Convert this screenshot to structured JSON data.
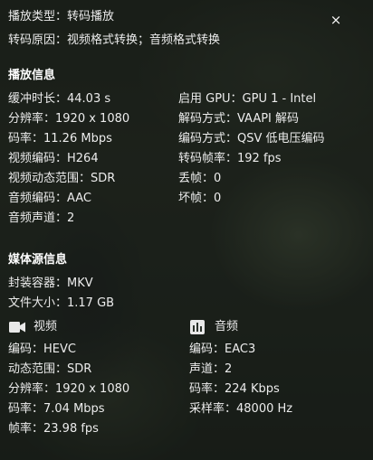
{
  "header": {
    "play_type": "播放类型：转码播放",
    "transcode_reason": "转码原因：视频格式转换；音频格式转换",
    "close_glyph": "×"
  },
  "playback": {
    "title": "播放信息",
    "left": [
      "缓冲时长：44.03 s",
      "分辨率：1920 x 1080",
      "码率：11.26 Mbps",
      "视频编码：H264",
      "视频动态范围：SDR",
      "音频编码：AAC",
      "音频声道：2"
    ],
    "right": [
      "启用 GPU：GPU 1 - Intel",
      "解码方式：VAAPI 解码",
      "编码方式：QSV 低电压编码",
      "转码帧率：192 fps",
      "丢帧：0",
      "坏帧：0"
    ]
  },
  "source": {
    "title": "媒体源信息",
    "container": "封装容器：MKV",
    "size": "文件大小：1.17 GB",
    "video": {
      "icon": "video-camera-icon",
      "label": "视频",
      "lines": [
        "编码：HEVC",
        "动态范围：SDR",
        "分辨率：1920 x 1080",
        "码率：7.04 Mbps",
        "帧率：23.98 fps"
      ]
    },
    "audio": {
      "icon": "audio-equalizer-icon",
      "label": "音频",
      "lines": [
        "编码：EAC3",
        "声道：2",
        "码率：224 Kbps",
        "采样率：48000 Hz"
      ]
    }
  }
}
